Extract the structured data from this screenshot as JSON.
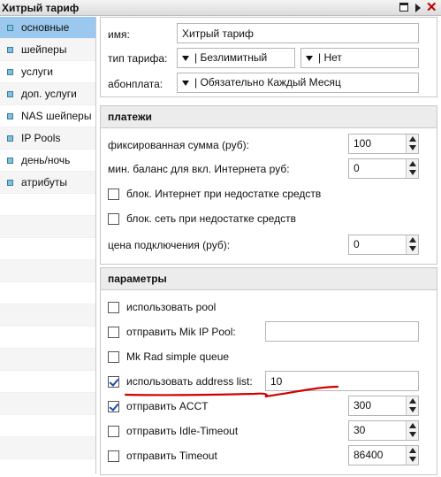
{
  "window": {
    "title": "Хитрый тариф",
    "close_glyph": "✕"
  },
  "sidebar": {
    "items": [
      {
        "label": "основные",
        "active": true
      },
      {
        "label": "шейперы"
      },
      {
        "label": "услуги"
      },
      {
        "label": "доп. услуги"
      },
      {
        "label": "NAS шейперы"
      },
      {
        "label": "IP Pools"
      },
      {
        "label": "день/ночь"
      },
      {
        "label": "атрибуты"
      }
    ]
  },
  "general": {
    "name_label": "имя:",
    "name_value": "Хитрый тариф",
    "type_label": "тип тарифа:",
    "type_value": "| Безлимитный",
    "type_value2": "| Нет",
    "fee_label": "абонплата:",
    "fee_value": "| Обязательно Каждый Месяц"
  },
  "payments": {
    "header": "платежи",
    "fixed_sum_label": "фиксированная сумма (руб):",
    "fixed_sum_value": "100",
    "min_balance_label": "мин. баланс для вкл. Интернета руб:",
    "min_balance_value": "0",
    "block_internet_label": "блок. Интернет при недостатке средств",
    "block_network_label": "блок. сеть при недостатке средств",
    "connect_price_label": "цена подключения (руб):",
    "connect_price_value": "0"
  },
  "params": {
    "header": "параметры",
    "use_pool_label": "использовать pool",
    "send_mik_pool_label": "отправить Mik IP Pool:",
    "send_mik_pool_value": "",
    "mk_rad_label": "Mk Rad simple queue",
    "use_address_list_label": "использовать address list:",
    "address_list_value": "10",
    "send_acct_label": "отправить ACCT",
    "send_acct_value": "300",
    "idle_timeout_label": "отправить Idle-Timeout",
    "idle_timeout_value": "30",
    "timeout_label": "отправить Timeout",
    "timeout_value": "86400"
  },
  "colors": {
    "active_tab": "#9bc8ee",
    "annotation_red": "#d00000",
    "check_blue": "#1a4bb0"
  }
}
